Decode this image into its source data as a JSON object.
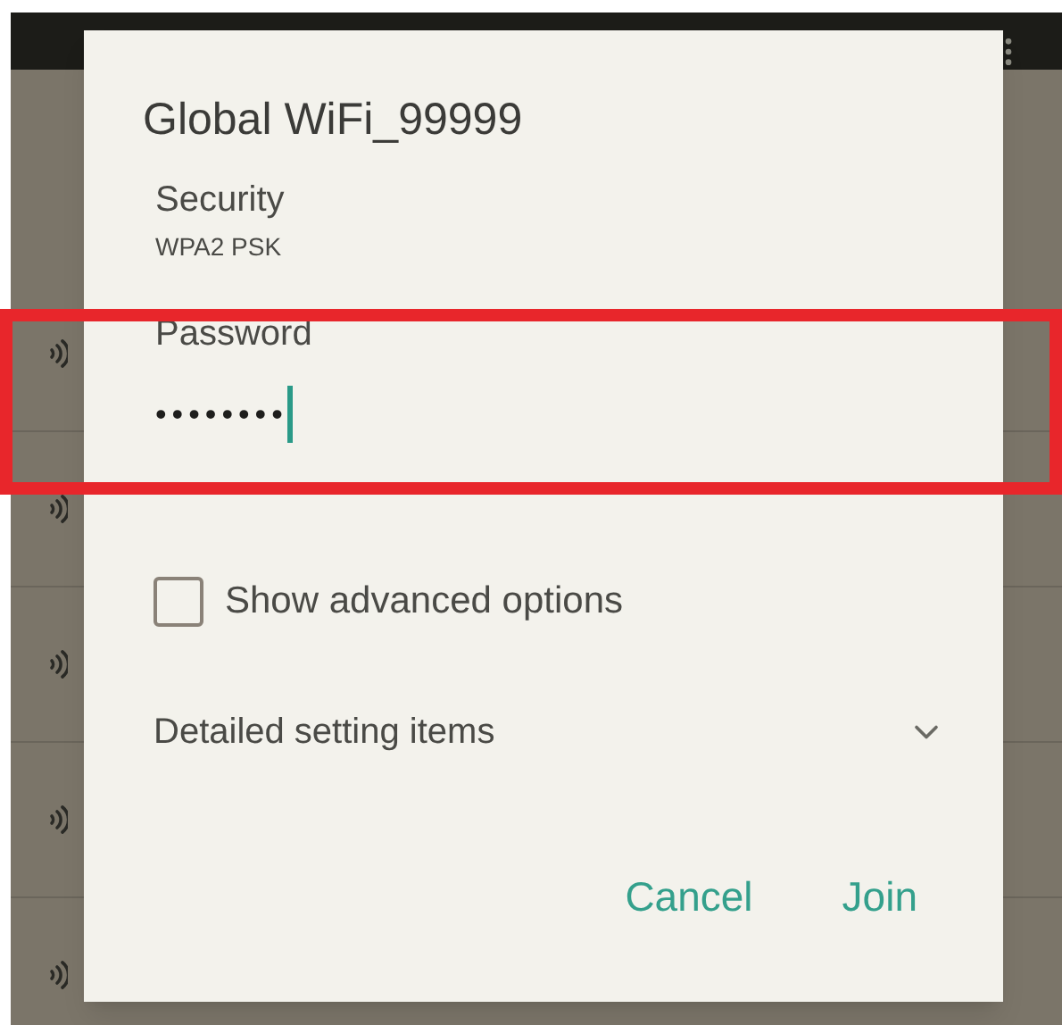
{
  "dialog": {
    "title": "Global WiFi_99999",
    "security": {
      "label": "Security",
      "value": "WPA2 PSK"
    },
    "password": {
      "label": "Password",
      "value": "••••••••",
      "focused": true,
      "highlighted": true
    },
    "advanced_options": {
      "label": "Show advanced options",
      "checked": false
    },
    "detailed_settings": {
      "label": "Detailed setting items",
      "expanded": false
    },
    "buttons": [
      {
        "label": "Cancel"
      },
      {
        "label": "Join"
      }
    ]
  }
}
